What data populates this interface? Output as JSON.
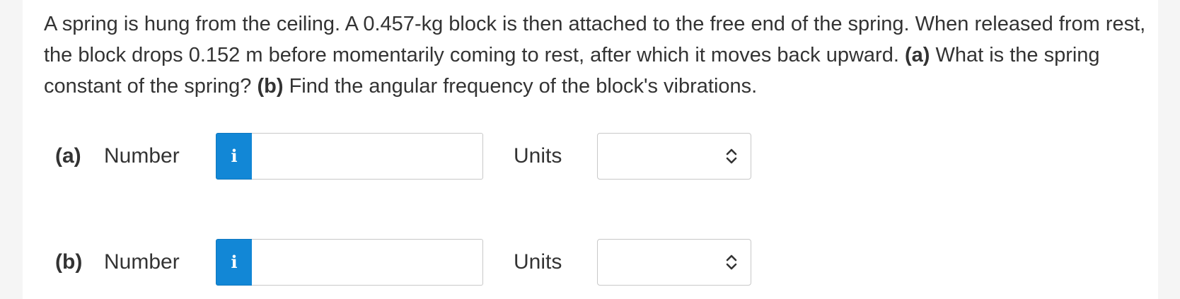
{
  "question": {
    "text_1": "A spring is hung from the ceiling. A 0.457-kg block is then attached to the free end of the spring. When released from rest, the block drops 0.152 m before momentarily coming to rest, after which it moves back upward. ",
    "bold_a": "(a)",
    "text_2": " What is the spring constant of the spring? ",
    "bold_b": "(b)",
    "text_3": " Find the angular frequency of the block's vibrations."
  },
  "parts": {
    "a": {
      "label": "(a)",
      "number_label": "Number",
      "info_icon": "i",
      "number_value": "",
      "units_label": "Units",
      "units_value": ""
    },
    "b": {
      "label": "(b)",
      "number_label": "Number",
      "info_icon": "i",
      "number_value": "",
      "units_label": "Units",
      "units_value": ""
    }
  },
  "colors": {
    "info_button": "#1287d6",
    "background": "#f5f5f5",
    "card": "#ffffff",
    "text": "#333333"
  },
  "icons": {
    "info": "info-icon",
    "select_chevron": "chevron-updown-icon"
  }
}
